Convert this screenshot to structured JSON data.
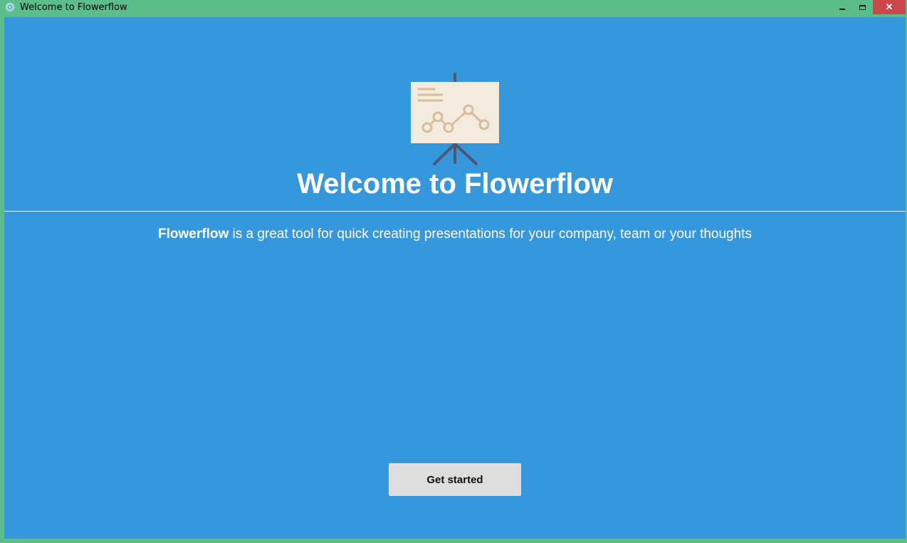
{
  "window": {
    "title": "Welcome to Flowerflow",
    "close_glyph": "✕",
    "icons": [
      "app-icon",
      "minimize-icon",
      "maximize-icon",
      "close-icon"
    ]
  },
  "colors": {
    "frame": "#5bbd89",
    "background": "#3598dc",
    "text": "#ffffff",
    "button_bg": "#dddddd",
    "board": "#f2ebde",
    "board_marks": "#d7be9b",
    "easel": "#4d5870",
    "close_button": "#c9494a"
  },
  "main": {
    "illustration": "presentation-board-icon",
    "heading": "Welcome to Flowerflow",
    "tagline_brand": "Flowerflow",
    "tagline_rest": " is a great tool for quick creating presentations for your company, team or your thoughts",
    "cta_label": "Get started"
  }
}
